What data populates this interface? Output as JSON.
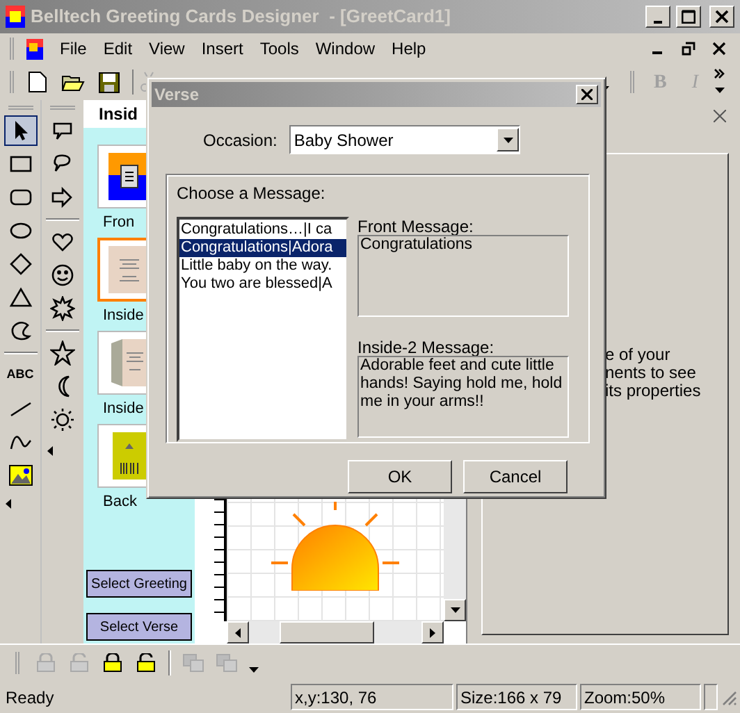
{
  "window": {
    "title": "Belltech Greeting Cards Designer  - [GreetCard1]"
  },
  "format_buttons": [
    {
      "kind": "bold",
      "label": "B"
    },
    {
      "kind": "italic",
      "label": "I"
    }
  ],
  "menu": [
    "File",
    "Edit",
    "View",
    "Insert",
    "Tools",
    "Window",
    "Help"
  ],
  "tools": [
    {
      "kind": "pointer",
      "selected": true
    },
    {
      "kind": "rect",
      "selected": false
    },
    {
      "kind": "rounded",
      "selected": false
    },
    {
      "kind": "ellipse",
      "selected": false
    },
    {
      "kind": "diamond",
      "selected": false
    },
    {
      "kind": "triangle",
      "selected": false
    },
    {
      "kind": "blob",
      "selected": false
    },
    {
      "kind": "text",
      "label": "ABC",
      "selected": false
    },
    {
      "kind": "line",
      "selected": false
    },
    {
      "kind": "curve",
      "selected": false
    },
    {
      "kind": "image",
      "selected": false
    }
  ],
  "shapes": [
    {
      "kind": "callout"
    },
    {
      "kind": "bubble"
    },
    {
      "kind": "arrow"
    },
    {
      "kind": "heart"
    },
    {
      "kind": "smiley"
    },
    {
      "kind": "burst"
    },
    {
      "kind": "star"
    },
    {
      "kind": "moon"
    },
    {
      "kind": "sun"
    }
  ],
  "pages_panel": {
    "header": "Insid",
    "pages": [
      {
        "kind": "front",
        "label": "Fron",
        "selected": false
      },
      {
        "kind": "inside",
        "label": "Inside",
        "selected": true
      },
      {
        "kind": "inside-open",
        "label": "Inside",
        "selected": false
      },
      {
        "kind": "back",
        "label": "Back",
        "selected": false
      }
    ],
    "buttons": [
      "Select Greeting",
      "Select Verse"
    ]
  },
  "properties_panel": {
    "lines": [
      "e of your",
      "nents to see",
      "its properties"
    ]
  },
  "status_bar": [
    "Ready",
    "x,y:130, 76",
    "Size:166 x 79",
    "Zoom:50%"
  ],
  "dialog": {
    "title": "Verse",
    "occasion_label": "Occasion:",
    "occasion": "Baby Shower",
    "group_label": "Choose a Message:",
    "messages": [
      {
        "text": "Congratulations…|I ca",
        "selected": false
      },
      {
        "text": "Congratulations|Adora",
        "selected": true
      },
      {
        "text": "Little baby on the way.",
        "selected": false
      },
      {
        "text": "You two are blessed|A",
        "selected": false
      }
    ],
    "front_label": "Front Message:",
    "front_message": "Congratulations",
    "inside_label": "Inside-2 Message:",
    "inside_message": "Adorable feet and cute little hands! Saying hold me, hold me in your arms!!",
    "buttons": [
      "OK",
      "Cancel"
    ]
  }
}
